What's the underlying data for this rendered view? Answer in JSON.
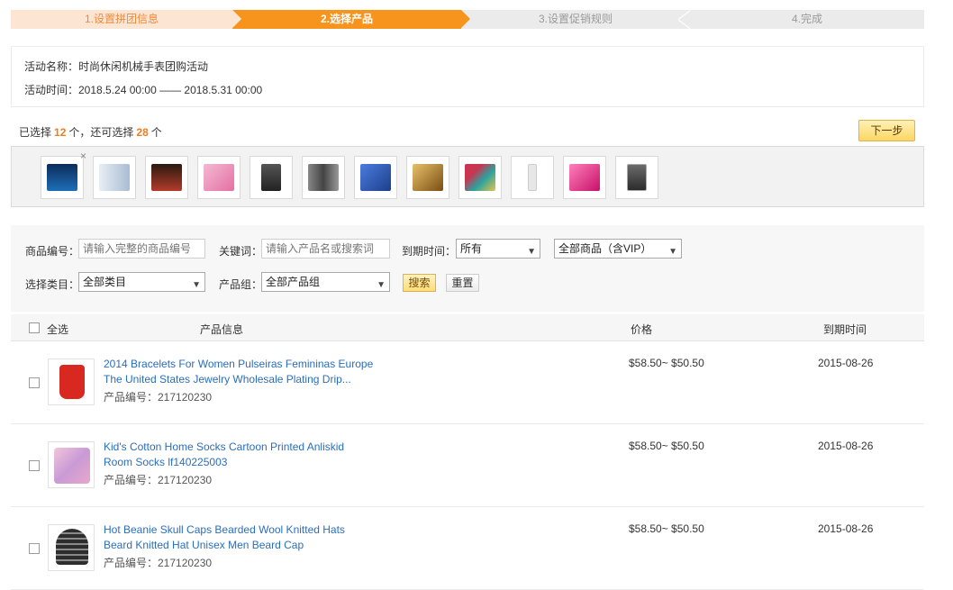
{
  "steps": [
    {
      "label": "1.设置拼团信息"
    },
    {
      "label": "2.选择产品"
    },
    {
      "label": "3.设置促销规则"
    },
    {
      "label": "4.完成"
    }
  ],
  "activity": {
    "name_line": "活动名称：时尚休闲机械手表团购活动",
    "time_line": "活动时间：2018.5.24 00:00 —— 2018.5.31 00:00"
  },
  "selection": {
    "prefix": "已选择",
    "selected_count": "12",
    "middle": "个，还可选择",
    "remaining_count": "28",
    "suffix": "个",
    "next_label": "下一步",
    "remove_symbol": "×"
  },
  "thumbnails": [
    {
      "name": "tablet-blue",
      "color": "#1e6fb8"
    },
    {
      "name": "phone-white",
      "color": "#c9d6e6"
    },
    {
      "name": "tablet-red",
      "color": "#b33b2a"
    },
    {
      "name": "tablet-pink-case",
      "color": "#e56fa3"
    },
    {
      "name": "phone-black",
      "color": "#3b3b3b"
    },
    {
      "name": "phone-pair",
      "color": "#6f6f6f"
    },
    {
      "name": "battery-blue",
      "color": "#2a56b8"
    },
    {
      "name": "usb-gold",
      "color": "#b88a2a"
    },
    {
      "name": "cables-color",
      "color": "#c8364f"
    },
    {
      "name": "cable-white",
      "color": "#dcdcdc"
    },
    {
      "name": "phone-pink-case",
      "color": "#e23a8a"
    },
    {
      "name": "phone-screen",
      "color": "#4a4a4a"
    }
  ],
  "filters": {
    "code_label": "商品编号：",
    "code_placeholder": "请输入完整的商品编号",
    "keyword_label": "关键词：",
    "keyword_placeholder": "请输入产品名或搜索词",
    "expire_label": "到期时间：",
    "expire_value": "所有",
    "scope_value": "全部商品（含VIP）",
    "category_label": "选择类目：",
    "category_value": "全部类目",
    "group_label": "产品组：",
    "group_value": "全部产品组",
    "search_label": "搜索",
    "reset_label": "重置"
  },
  "table": {
    "columns": {
      "select_all": "全选",
      "product_info": "产品信息",
      "price": "价格",
      "expire": "到期时间"
    },
    "rows": [
      {
        "title": "2014 Bracelets For Women Pulseiras Femininas Europe The United States Jewelry Wholesale Plating Drip...",
        "code": "产品编号：217120230",
        "price": "$58.50~ $50.50",
        "expire": "2015-08-26",
        "img_color": "#d9281f"
      },
      {
        "title": "Kid's Cotton Home Socks Cartoon Printed Anliskid Room Socks lf140225003",
        "code": "产品编号：217120230",
        "price": "$58.50~ $50.50",
        "expire": "2015-08-26",
        "img_color": "#e7a8c9"
      },
      {
        "title": "Hot Beanie Skull Caps Bearded Wool Knitted Hats Beard Knitted Hat Unisex Men Beard Cap",
        "code": "产品编号：217120230",
        "price": "$58.50~ $50.50",
        "expire": "2015-08-26",
        "img_color": "#2d2d2d"
      }
    ]
  },
  "colors": {
    "accent_orange": "#f7941d",
    "link_blue": "#2a6ebb",
    "count_orange": "#f07c1e"
  }
}
